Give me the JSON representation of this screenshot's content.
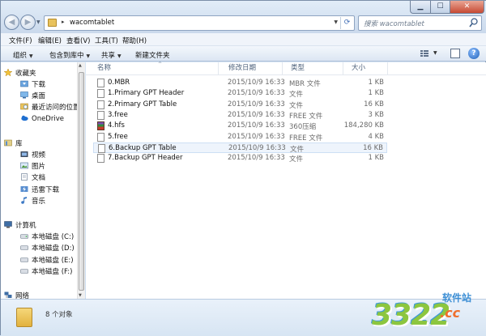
{
  "address": {
    "path": "wacomtablet",
    "separator": "▸"
  },
  "search": {
    "placeholder": "搜索 wacomtablet"
  },
  "menu": [
    "文件(F)",
    "编辑(E)",
    "查看(V)",
    "工具(T)",
    "帮助(H)"
  ],
  "toolbar": {
    "organize": "组织",
    "include_in_library": "包含到库中",
    "share": "共享",
    "new_folder": "新建文件夹"
  },
  "nav": {
    "favorites": "收藏夹",
    "downloads": "下载",
    "desktop": "桌面",
    "recent": "最近访问的位置",
    "onedrive": "OneDrive",
    "libraries": "库",
    "videos": "视频",
    "pictures": "图片",
    "documents": "文档",
    "thunder": "迅雷下载",
    "music": "音乐",
    "computer": "计算机",
    "disk_c": "本地磁盘 (C:)",
    "disk_d": "本地磁盘 (D:)",
    "disk_e": "本地磁盘 (E:)",
    "disk_f": "本地磁盘 (F:)",
    "network": "网络"
  },
  "columns": {
    "name": "名称",
    "date": "修改日期",
    "type": "类型",
    "size": "大小"
  },
  "files": [
    {
      "name": "0.MBR",
      "date": "2015/10/9 16:33",
      "type": "MBR 文件",
      "size": "1 KB"
    },
    {
      "name": "1.Primary GPT Header",
      "date": "2015/10/9 16:33",
      "type": "文件",
      "size": "1 KB"
    },
    {
      "name": "2.Primary GPT Table",
      "date": "2015/10/9 16:33",
      "type": "文件",
      "size": "16 KB"
    },
    {
      "name": "3.free",
      "date": "2015/10/9 16:33",
      "type": "FREE 文件",
      "size": "3 KB"
    },
    {
      "name": "4.hfs",
      "date": "2015/10/9 16:33",
      "type": "360压缩",
      "size": "184,280 KB"
    },
    {
      "name": "5.free",
      "date": "2015/10/9 16:33",
      "type": "FREE 文件",
      "size": "4 KB"
    },
    {
      "name": "6.Backup GPT Table",
      "date": "2015/10/9 16:33",
      "type": "文件",
      "size": "16 KB"
    },
    {
      "name": "7.Backup GPT Header",
      "date": "2015/10/9 16:33",
      "type": "文件",
      "size": "1 KB"
    }
  ],
  "status": {
    "count": "8 个对象"
  },
  "watermark": {
    "number": "3322",
    "site": "软件站",
    "domain": ".cc"
  }
}
